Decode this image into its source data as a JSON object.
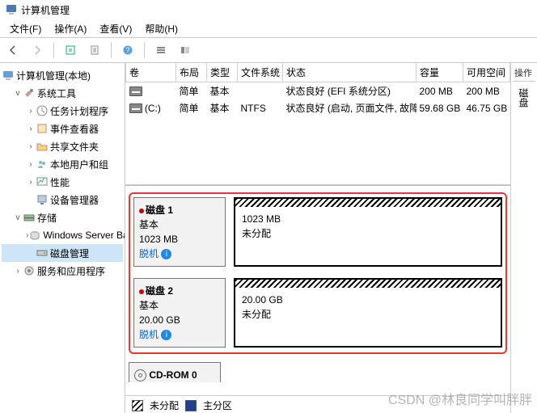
{
  "title": "计算机管理",
  "menu": {
    "file": "文件(F)",
    "action": "操作(A)",
    "view": "查看(V)",
    "help": "帮助(H)"
  },
  "tree": {
    "root": "计算机管理(本地)",
    "system_tools": "系统工具",
    "scheduler": "任务计划程序",
    "event": "事件查看器",
    "shared": "共享文件夹",
    "local_users": "本地用户和组",
    "perf": "性能",
    "devmgr": "设备管理器",
    "storage": "存储",
    "wsb": "Windows Server Back",
    "diskmgmt": "磁盘管理",
    "services": "服务和应用程序"
  },
  "cols": {
    "vol": "卷",
    "layout": "布局",
    "type": "类型",
    "fs": "文件系统",
    "status": "状态",
    "cap": "容量",
    "free": "可用空间"
  },
  "vol": [
    {
      "name": "",
      "letter": "",
      "layout": "简单",
      "type": "基本",
      "fs": "",
      "status": "状态良好 (EFI 系统分区)",
      "cap": "200 MB",
      "free": "200 MB"
    },
    {
      "name": "",
      "letter": "(C:)",
      "layout": "简单",
      "type": "基本",
      "fs": "NTFS",
      "status": "状态良好 (启动, 页面文件, 故障转储, 主分区)",
      "cap": "59.68 GB",
      "free": "46.75 GB"
    }
  ],
  "disks": [
    {
      "name": "磁盘 1",
      "type": "基本",
      "size": "1023 MB",
      "state": "脱机",
      "part_size": "1023 MB",
      "part_state": "未分配"
    },
    {
      "name": "磁盘 2",
      "type": "基本",
      "size": "20.00 GB",
      "state": "脱机",
      "part_size": "20.00 GB",
      "part_state": "未分配"
    }
  ],
  "cdrom": "CD-ROM 0",
  "legend": {
    "un": "未分配",
    "pri": "主分区"
  },
  "actions_hdr": "操作",
  "actions_item": "磁盘",
  "watermark": "CSDN @林良同学叫胖胖"
}
